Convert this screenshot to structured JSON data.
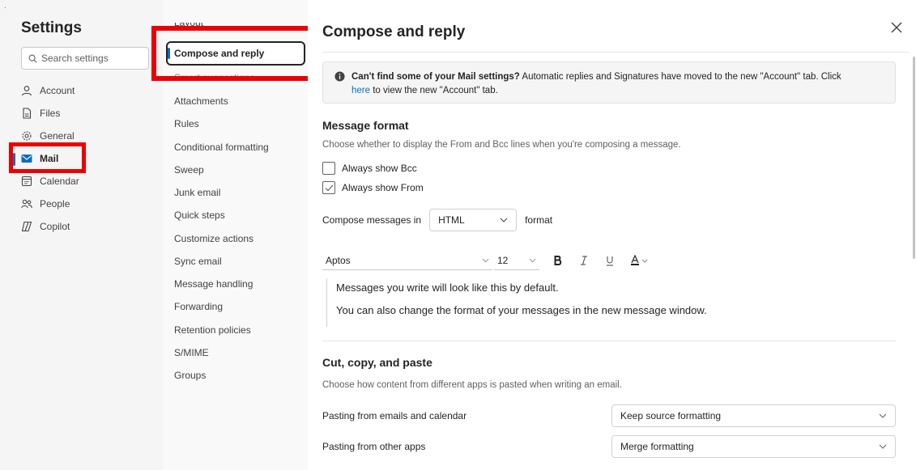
{
  "sidebar": {
    "title": "Settings",
    "search_placeholder": "Search settings",
    "items": [
      {
        "label": "Account",
        "icon": "person-icon"
      },
      {
        "label": "Files",
        "icon": "file-icon"
      },
      {
        "label": "General",
        "icon": "gear-icon"
      },
      {
        "label": "Mail",
        "icon": "mail-icon",
        "active": true
      },
      {
        "label": "Calendar",
        "icon": "calendar-icon"
      },
      {
        "label": "People",
        "icon": "people-icon"
      },
      {
        "label": "Copilot",
        "icon": "copilot-icon"
      }
    ]
  },
  "mail_nav": {
    "clipped_top": "Layout",
    "selected": "Compose and reply",
    "clipped_below": "Smart suggestions",
    "items": [
      "Attachments",
      "Rules",
      "Conditional formatting",
      "Sweep",
      "Junk email",
      "Quick steps",
      "Customize actions",
      "Sync email",
      "Message handling",
      "Forwarding",
      "Retention policies",
      "S/MIME",
      "Groups"
    ]
  },
  "main": {
    "title": "Compose and reply",
    "info": {
      "bold": "Can't find some of your Mail settings?",
      "text": " Automatic replies and Signatures have moved to the new \"Account\" tab. Click",
      "link": "here",
      "tail": " to view the new \"Account\" tab."
    },
    "message_format": {
      "heading": "Message format",
      "description": "Choose whether to display the From and Bcc lines when you're composing a message.",
      "always_show_bcc": {
        "label": "Always show Bcc",
        "checked": false
      },
      "always_show_from": {
        "label": "Always show From",
        "checked": true
      },
      "compose_prefix": "Compose messages in",
      "compose_value": "HTML",
      "compose_suffix": "format",
      "font": "Aptos",
      "size": "12",
      "preview_line1": "Messages you write will look like this by default.",
      "preview_line2": "You can also change the format of your messages in the new message window."
    },
    "cut_copy_paste": {
      "heading": "Cut, copy, and paste",
      "description": "Choose how content from different apps is pasted when writing an email.",
      "rows": [
        {
          "label": "Pasting from emails and calendar",
          "value": "Keep source formatting"
        },
        {
          "label": "Pasting from other apps",
          "value": "Merge formatting"
        }
      ]
    }
  },
  "colors": {
    "accent": "#0f6cbd",
    "highlight": "#ee0000"
  }
}
